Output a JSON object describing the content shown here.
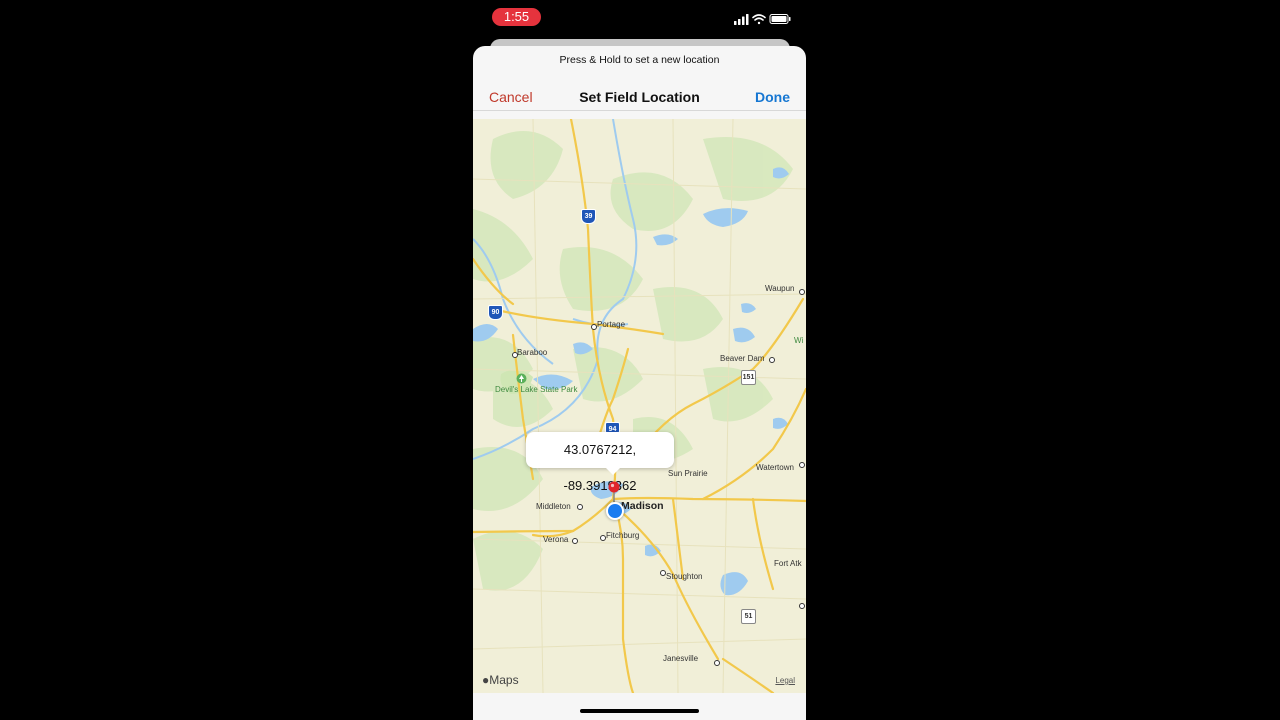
{
  "status_bar": {
    "time": "1:55"
  },
  "sheet": {
    "hint": "Press & Hold to set a new location",
    "cancel_label": "Cancel",
    "title": "Set Field Location",
    "done_label": "Done"
  },
  "map": {
    "places": {
      "portage": "Portage",
      "baraboo": "Baraboo",
      "devils_lake": "Devil's Lake State Park",
      "waupun": "Waupun",
      "beaver_dam": "Beaver Dam",
      "sun_prairie": "Sun Prairie",
      "watertown": "Watertown",
      "madison": "Madison",
      "middleton": "Middleton",
      "verona": "Verona",
      "fitchburg": "Fitchburg",
      "stoughton": "Stoughton",
      "fort_atkinson": "Fort Atk",
      "janesville": "Janesville",
      "wi": "Wi"
    },
    "shields": {
      "i39": "39",
      "i90": "90",
      "i94": "94",
      "us151": "151",
      "us51": "51"
    },
    "coordinates": "43.0767212, -89.3919362",
    "attribution": "Maps",
    "legal": "Legal"
  },
  "colors": {
    "accent_cancel": "#c0392b",
    "accent_done": "#1677d2",
    "time_pill": "#e5333d",
    "pin": "#e0262b",
    "user_location": "#1a7cf0",
    "water": "#9fcbef",
    "road": "#f2c84b",
    "park": "#cfe6b4"
  },
  "icons": [
    "signal-icon",
    "wifi-icon",
    "battery-icon",
    "map-pin-icon",
    "user-location-icon",
    "apple-logo-icon",
    "park-icon"
  ]
}
